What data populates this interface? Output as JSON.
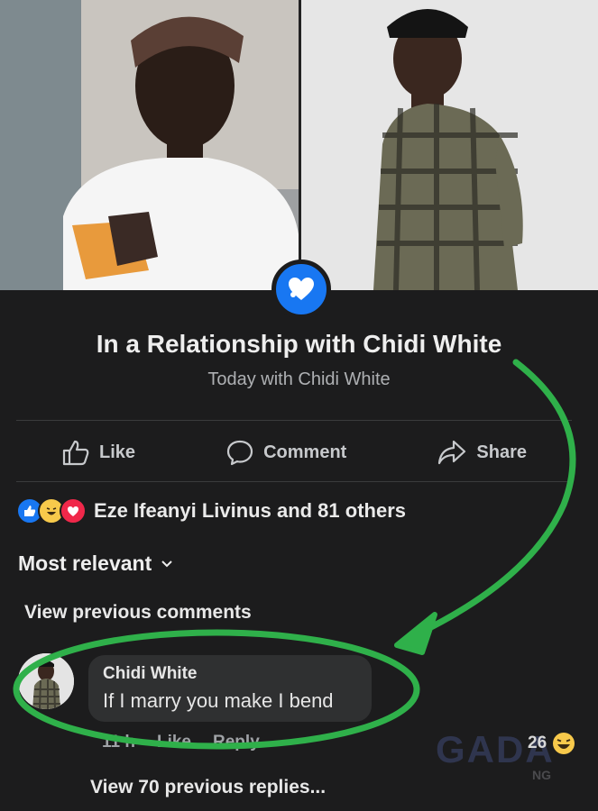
{
  "relationship": {
    "title": "In a Relationship with Chidi White",
    "subtitle": "Today with Chidi White"
  },
  "actions": [
    {
      "label": "Like",
      "icon": "thumbs-up-icon"
    },
    {
      "label": "Comment",
      "icon": "comment-icon"
    },
    {
      "label": "Share",
      "icon": "share-icon"
    }
  ],
  "reactions": {
    "summary": "Eze Ifeanyi Livinus and 81 others",
    "icons": [
      "like-reaction-icon",
      "haha-reaction-icon",
      "love-reaction-icon"
    ]
  },
  "sort": {
    "label": "Most relevant"
  },
  "comments": {
    "view_previous": "View previous comments",
    "items": [
      {
        "author": "Chidi White",
        "text": "If I marry you make I bend",
        "time": "11 h",
        "like_label": "Like",
        "reply_label": "Reply",
        "reaction_count": "26"
      }
    ],
    "view_replies": "View 70 previous replies..."
  },
  "watermark": {
    "text": "GADA",
    "sub": "NG"
  },
  "colors": {
    "background": "#1c1c1d",
    "accent_blue": "#1877f2",
    "annotation_green": "#2fb04a",
    "bubble": "#2f3031"
  }
}
